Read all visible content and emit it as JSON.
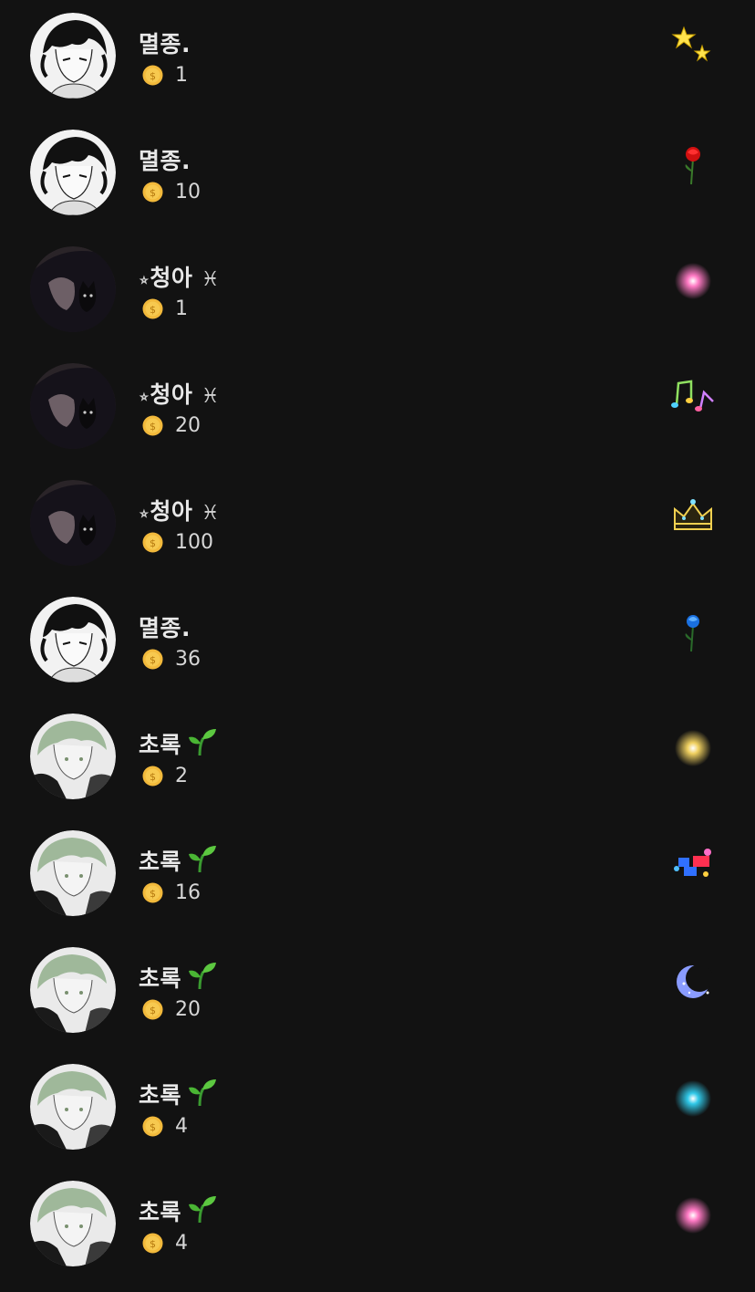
{
  "colors": {
    "background": "#121212",
    "text": "#e8e8e8",
    "coin": "#f2b93b"
  },
  "items": [
    {
      "user": "멸종.",
      "avatar": "avatar-boy-icon",
      "coins": "1",
      "gift": "stars-icon"
    },
    {
      "user": "멸종.",
      "avatar": "avatar-boy-icon",
      "coins": "10",
      "gift": "red-rose-icon"
    },
    {
      "user": "청아",
      "deco_left": "⭒",
      "deco_right": "♓",
      "avatar": "avatar-dark-cat-icon",
      "coins": "1",
      "gift": "pink-firework-icon"
    },
    {
      "user": "청아",
      "deco_left": "⭒",
      "deco_right": "♓",
      "avatar": "avatar-dark-cat-icon",
      "coins": "20",
      "gift": "music-notes-icon"
    },
    {
      "user": "청아",
      "deco_left": "⭒",
      "deco_right": "♓",
      "avatar": "avatar-dark-cat-icon",
      "coins": "100",
      "gift": "crown-icon"
    },
    {
      "user": "멸종.",
      "avatar": "avatar-boy-icon",
      "coins": "36",
      "gift": "blue-rose-icon"
    },
    {
      "user": "초록",
      "sprout": true,
      "avatar": "avatar-green-hair-icon",
      "coins": "2",
      "gift": "gold-firework-icon"
    },
    {
      "user": "초록",
      "sprout": true,
      "avatar": "avatar-green-hair-icon",
      "coins": "16",
      "gift": "sticker-icon"
    },
    {
      "user": "초록",
      "sprout": true,
      "avatar": "avatar-green-hair-icon",
      "coins": "20",
      "gift": "moon-icon"
    },
    {
      "user": "초록",
      "sprout": true,
      "avatar": "avatar-green-hair-icon",
      "coins": "4",
      "gift": "cyan-firework-icon"
    },
    {
      "user": "초록",
      "sprout": true,
      "avatar": "avatar-green-hair-icon",
      "coins": "4",
      "gift": "pink-firework-icon"
    }
  ]
}
